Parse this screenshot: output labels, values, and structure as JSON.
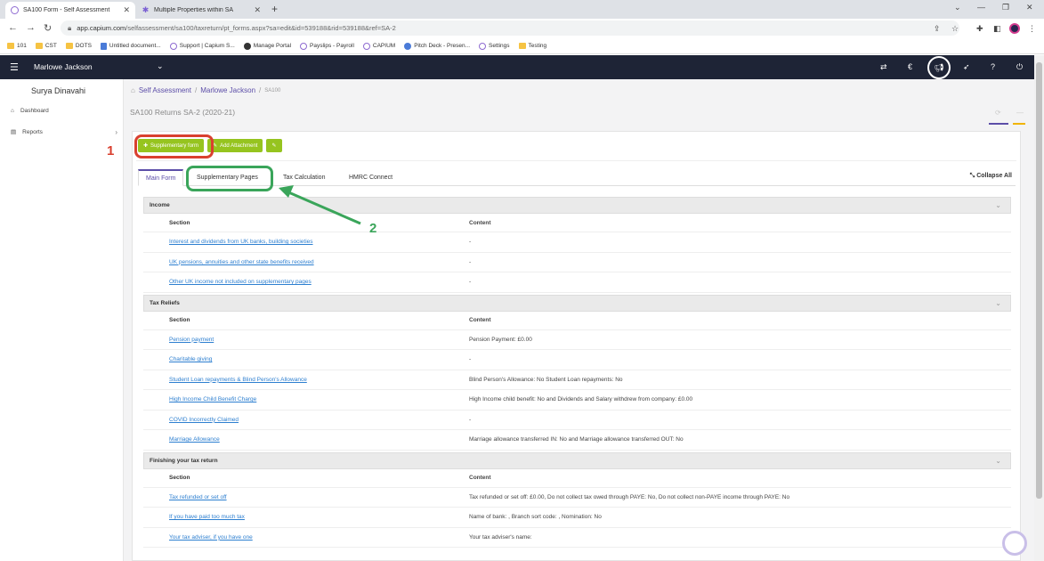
{
  "browser": {
    "tabs": [
      {
        "title": "SA100 Form - Self Assessment",
        "active": true
      },
      {
        "title": "Multiple Properties within SA",
        "active": false
      }
    ],
    "new_tab": "+",
    "url_host": "app.capium.com",
    "url_path": "/selfassessment/sa100/taxreturn/pt_forms.aspx?sa=edit&id=539188&rid=539188&ref=SA-2",
    "bookmarks": [
      "101",
      "CST",
      "DOTS",
      "Untitled document...",
      "Support | Capium S...",
      "Manage Portal",
      "Payslips - Payroll",
      "CAPIUM",
      "Pitch Deck - Presen...",
      "Settings",
      "Testing"
    ]
  },
  "appbar": {
    "client_name": "Marlowe Jackson"
  },
  "sidebar": {
    "user_name": "Surya Dinavahi",
    "items": [
      {
        "label": "Dashboard"
      },
      {
        "label": "Reports"
      }
    ]
  },
  "breadcrumb": {
    "item1": "Self Assessment",
    "sep": "/",
    "item2": "Marlowe Jackson",
    "item3": "SA100"
  },
  "page_title": "SA100 Returns SA-2 (2020-21)",
  "toolbar": {
    "supplementary_form": "Supplementary form",
    "add_attachment": "Add Attachment"
  },
  "tabs": [
    {
      "label": "Main Form",
      "active": true
    },
    {
      "label": "Supplementary Pages",
      "active": false
    },
    {
      "label": "Tax Calculation",
      "active": false
    },
    {
      "label": "HMRC Connect",
      "active": false
    }
  ],
  "collapse_all": "Collapse All",
  "columns": {
    "section": "Section",
    "content": "Content"
  },
  "sections": [
    {
      "title": "Income",
      "rows": [
        {
          "section": "Interest and dividends from UK banks, building societies",
          "content": "-"
        },
        {
          "section": "UK pensions, annuities and other state benefits received",
          "content": "-"
        },
        {
          "section": "Other UK income not included on supplementary pages",
          "content": "-"
        }
      ]
    },
    {
      "title": "Tax Reliefs",
      "rows": [
        {
          "section": "Pension payment",
          "content": "Pension Payment: £0.00"
        },
        {
          "section": "Charitable giving",
          "content": "-"
        },
        {
          "section": "Student Loan repayments & Blind Person's Allowance",
          "content": "Blind Person's Allowance: No Student Loan repayments: No"
        },
        {
          "section": "High Income Child Benefit Charge",
          "content": "High Income child benefit: No and Dividends and Salary withdrew from company: £0.00"
        },
        {
          "section": "COVID Incorrectly Claimed",
          "content": "-"
        },
        {
          "section": "Marriage Allowance",
          "content": "Marriage allowance transferred IN: No and Marriage allowance transferred OUT: No"
        }
      ]
    },
    {
      "title": "Finishing your tax return",
      "rows": [
        {
          "section": "Tax refunded or set off",
          "content": "Tax refunded or set off: £0.00, Do not collect tax owed through PAYE: No, Do not collect non-PAYE income through PAYE: No"
        },
        {
          "section": "If you have paid too much tax",
          "content": "Name of bank: , Branch sort code: , Nomination: No"
        },
        {
          "section": "Your tax adviser, if you have one",
          "content": "Your tax adviser's name:"
        }
      ]
    }
  ],
  "annotations": {
    "label1": "1",
    "label2": "2"
  },
  "colors": {
    "accent": "#5c4ea8",
    "green_button": "#96c41f",
    "annotation_red": "#d9402f",
    "annotation_green": "#3aa55a",
    "header_bg": "#1e2436"
  },
  "icons": [
    "hamburger-icon",
    "chevron-down-icon",
    "transfer-icon",
    "capium-icon",
    "megaphone-icon",
    "rocket-icon",
    "help-icon",
    "power-icon",
    "home-icon",
    "dashboard-icon",
    "reports-icon",
    "plus-icon",
    "paperclip-icon",
    "edit-icon",
    "collapse-icon"
  ]
}
